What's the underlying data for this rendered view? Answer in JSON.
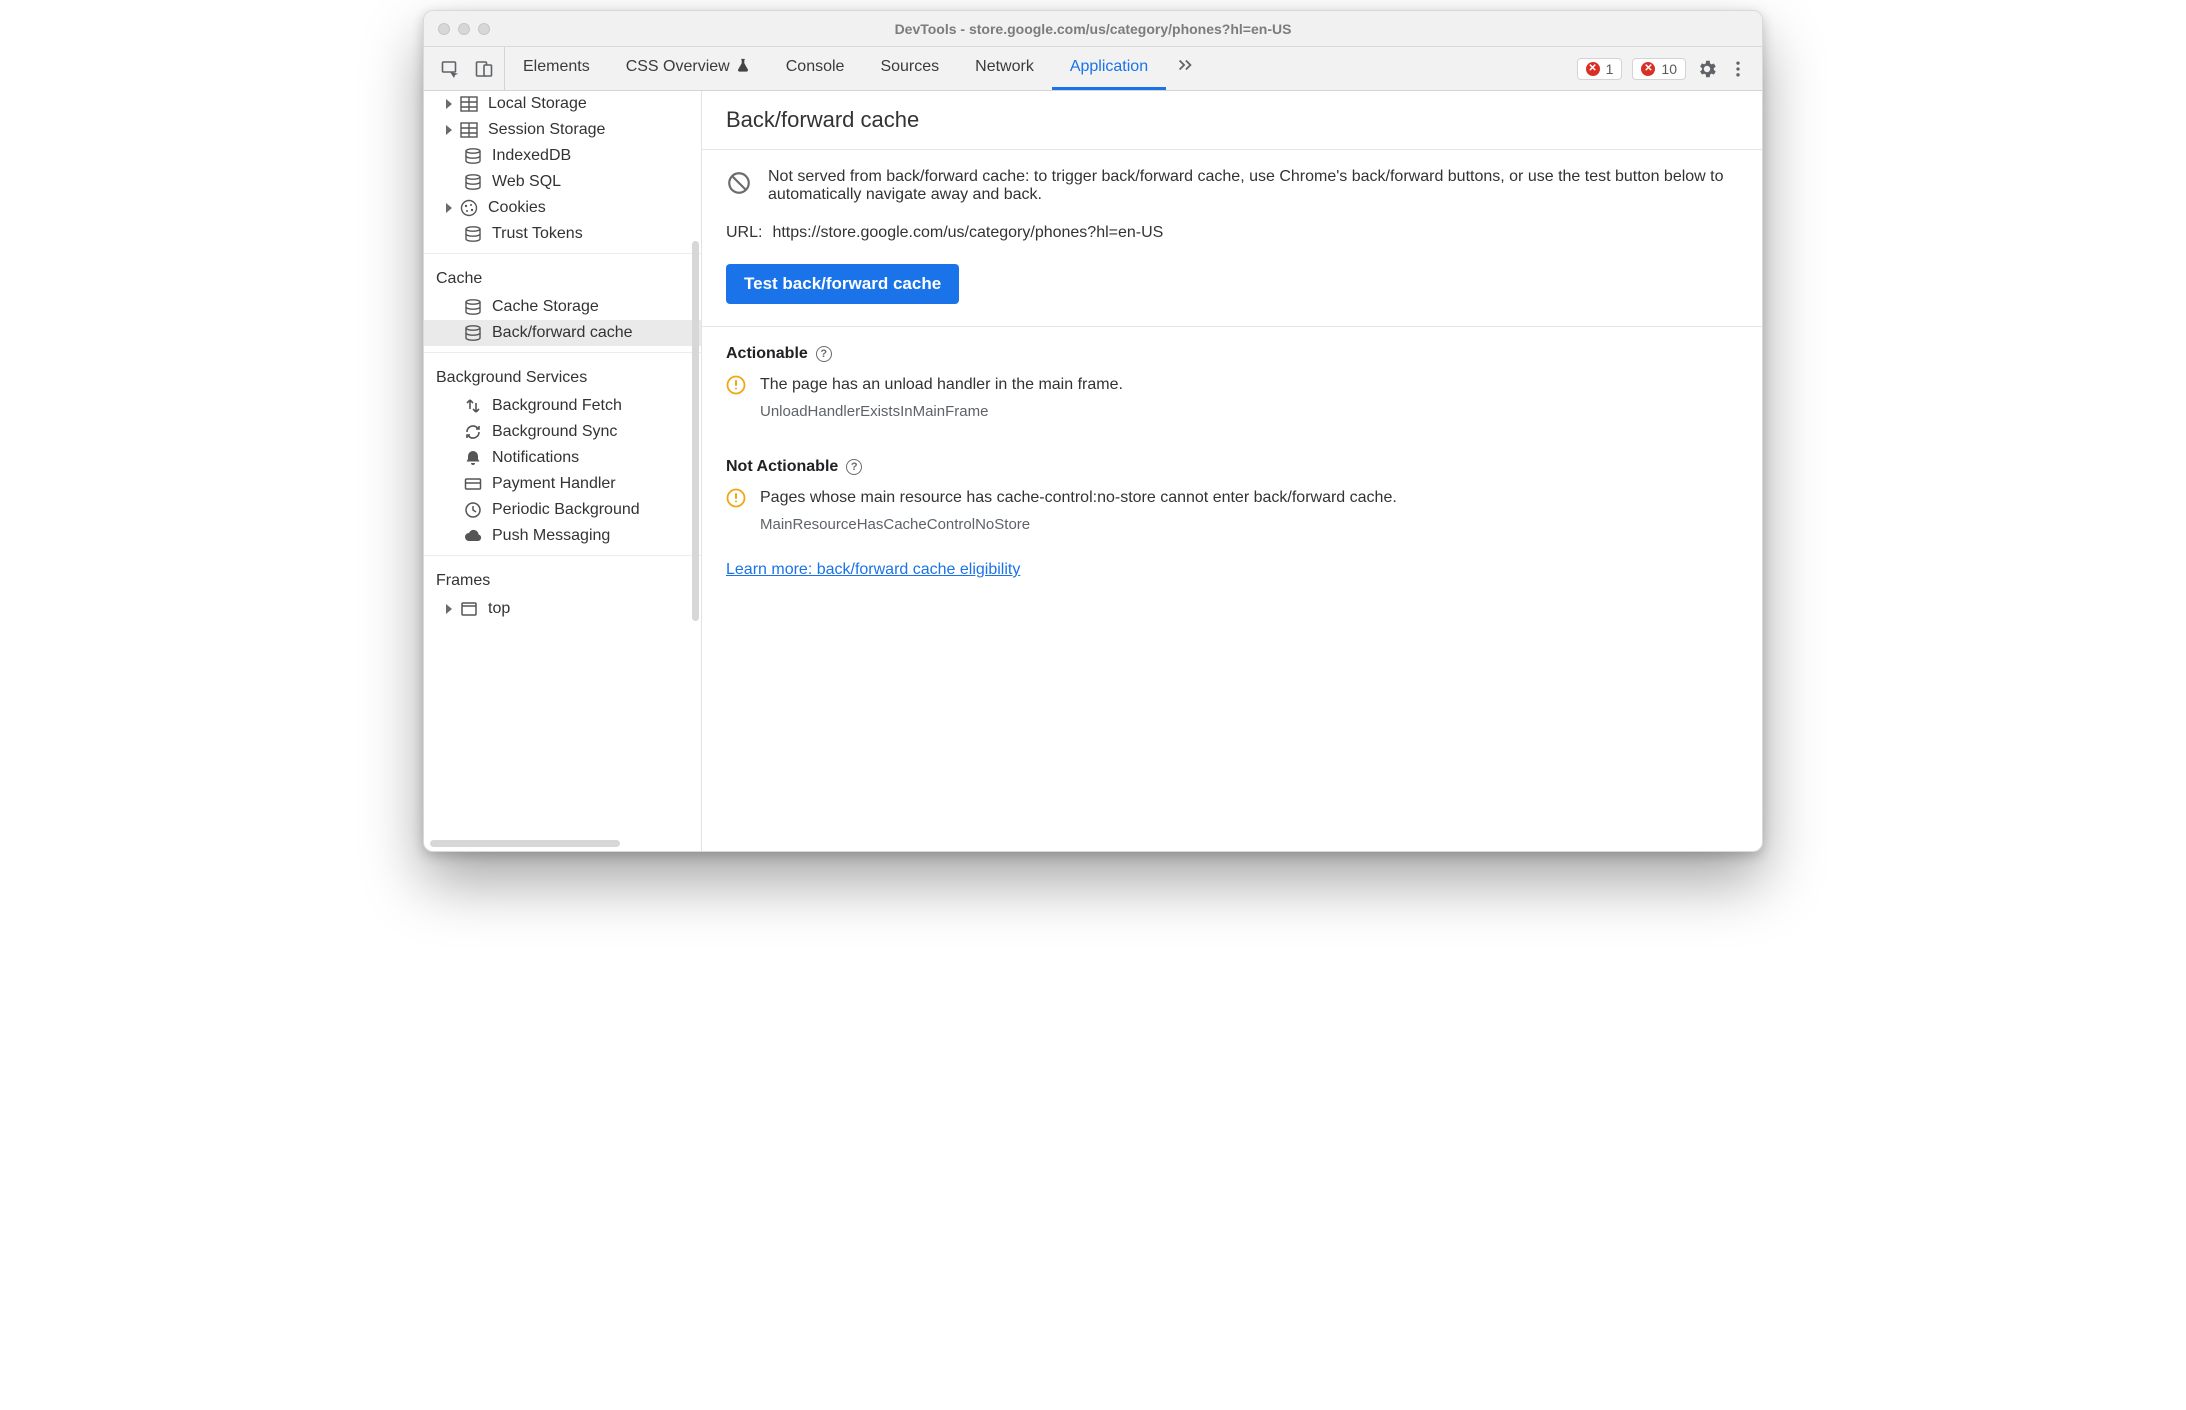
{
  "window": {
    "title": "DevTools - store.google.com/us/category/phones?hl=en-US"
  },
  "tabs": {
    "elements": "Elements",
    "css_overview": "CSS Overview",
    "console": "Console",
    "sources": "Sources",
    "network": "Network",
    "application": "Application"
  },
  "badges": {
    "errors": "1",
    "issues": "10"
  },
  "sidebar": {
    "storage": {
      "local": "Local Storage",
      "session": "Session Storage",
      "indexeddb": "IndexedDB",
      "websql": "Web SQL",
      "cookies": "Cookies",
      "trust": "Trust Tokens"
    },
    "cache": {
      "heading": "Cache",
      "items": {
        "storage": "Cache Storage",
        "bf": "Back/forward cache"
      }
    },
    "bg": {
      "heading": "Background Services",
      "items": {
        "fetch": "Background Fetch",
        "sync": "Background Sync",
        "notif": "Notifications",
        "payment": "Payment Handler",
        "periodic": "Periodic Background",
        "push": "Push Messaging"
      }
    },
    "frames": {
      "heading": "Frames",
      "top": "top"
    }
  },
  "main": {
    "title": "Back/forward cache",
    "info": "Not served from back/forward cache: to trigger back/forward cache, use Chrome's back/forward buttons, or use the test button below to automatically navigate away and back.",
    "url_label": "URL:",
    "url_value": "https://store.google.com/us/category/phones?hl=en-US",
    "test_btn": "Test back/forward cache",
    "actionable": {
      "title": "Actionable",
      "item": {
        "msg": "The page has an unload handler in the main frame.",
        "code": "UnloadHandlerExistsInMainFrame"
      }
    },
    "not_actionable": {
      "title": "Not Actionable",
      "item": {
        "msg": "Pages whose main resource has cache-control:no-store cannot enter back/forward cache.",
        "code": "MainResourceHasCacheControlNoStore"
      }
    },
    "learn_more": "Learn more: back/forward cache eligibility"
  }
}
